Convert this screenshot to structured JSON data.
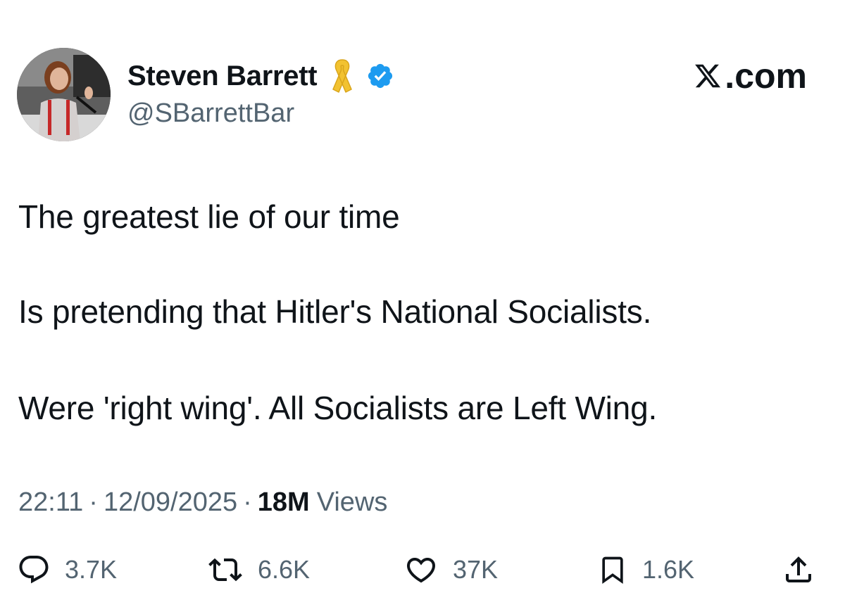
{
  "tweet": {
    "author": {
      "display_name": "Steven Barrett",
      "handle": "@SBarrettBar",
      "badges": [
        "yellow-ribbon-icon",
        "verified-badge-icon"
      ]
    },
    "brand": {
      "label": ".com",
      "logo": "x-logo-icon"
    },
    "text_lines": [
      "The greatest lie of our time",
      "Is pretending that Hitler's National Socialists.",
      "Were 'right wing'. All Socialists are Left Wing."
    ],
    "meta": {
      "time": "22:11",
      "separator": "·",
      "date": "12/09/2025",
      "views_count": "18M",
      "views_label": "Views"
    },
    "actions": {
      "replies": "3.7K",
      "reposts": "6.6K",
      "likes": "37K",
      "bookmarks": "1.6K"
    }
  },
  "colors": {
    "text_primary": "#0f1419",
    "text_secondary": "#536471",
    "verified_blue": "#1d9bf0",
    "ribbon_yellow": "#f2c230"
  }
}
